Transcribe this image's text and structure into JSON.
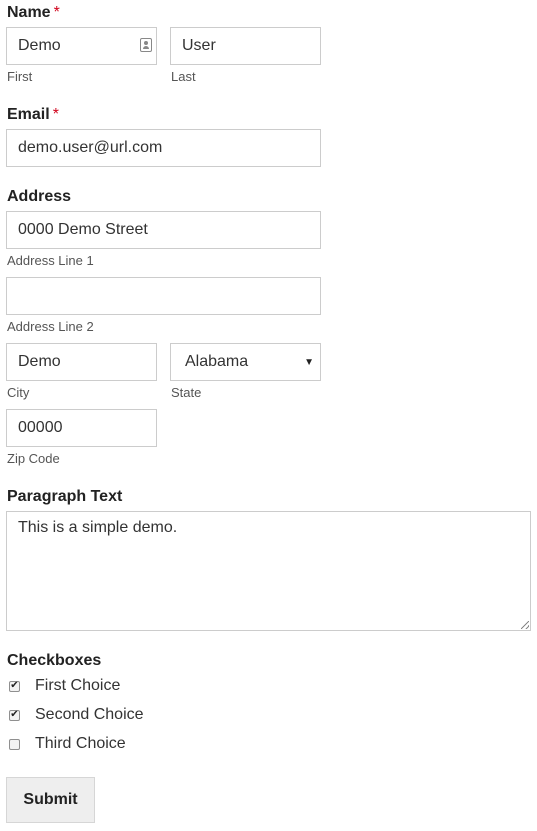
{
  "name": {
    "label": "Name",
    "required_mark": "*",
    "first": {
      "value": "Demo",
      "sublabel": "First",
      "icon": "contact-card-icon"
    },
    "last": {
      "value": "User",
      "sublabel": "Last"
    }
  },
  "email": {
    "label": "Email",
    "required_mark": "*",
    "value": "demo.user@url.com"
  },
  "address": {
    "label": "Address",
    "line1": {
      "value": "0000 Demo Street",
      "sublabel": "Address Line 1"
    },
    "line2": {
      "value": "",
      "sublabel": "Address Line 2"
    },
    "city": {
      "value": "Demo",
      "sublabel": "City"
    },
    "state": {
      "value": "Alabama",
      "sublabel": "State"
    },
    "zip": {
      "value": "00000",
      "sublabel": "Zip Code"
    }
  },
  "paragraph": {
    "label": "Paragraph Text",
    "value": "This is a simple demo."
  },
  "checkboxes": {
    "label": "Checkboxes",
    "items": [
      {
        "label": "First Choice",
        "checked": true
      },
      {
        "label": "Second Choice",
        "checked": true
      },
      {
        "label": "Third Choice",
        "checked": false
      }
    ]
  },
  "submit": {
    "label": "Submit"
  },
  "colors": {
    "required": "#d0021b",
    "border": "#cccccc",
    "button_bg": "#eeeeee"
  }
}
